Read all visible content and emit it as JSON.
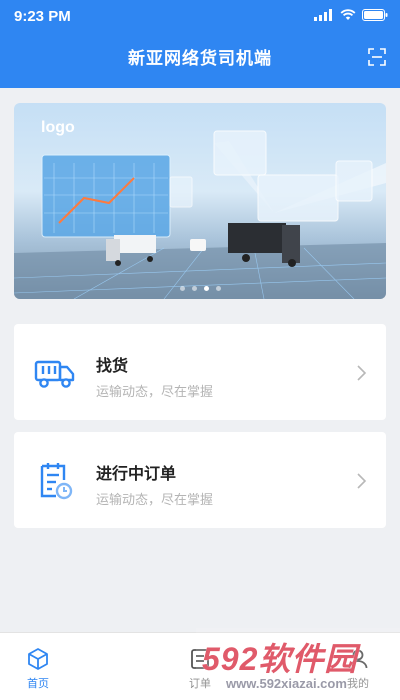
{
  "status_bar": {
    "time": "9:23 PM"
  },
  "header": {
    "title": "新亚网络货司机端",
    "scan_icon": "scan-icon"
  },
  "banner": {
    "logo_text": "logo",
    "slide_count": 4,
    "active_slide": 3
  },
  "cards": [
    {
      "title": "找货",
      "subtitle": "运输动态，尽在掌握",
      "icon": "truck-icon"
    },
    {
      "title": "进行中订单",
      "subtitle": "运输动态，尽在掌握",
      "icon": "order-clipboard-icon"
    }
  ],
  "tabbar": {
    "items": [
      {
        "label": "首页",
        "icon": "home-cube-icon",
        "active": true
      },
      {
        "label": "订单",
        "icon": "order-list-icon",
        "active": false
      },
      {
        "label": "我的",
        "icon": "user-icon",
        "active": false
      }
    ]
  },
  "watermark": {
    "brand": "592软件园",
    "url": "www.592xiazai.com"
  },
  "colors": {
    "primary": "#2f86f2",
    "background": "#eef0f3",
    "watermark": "#e05a6a"
  }
}
